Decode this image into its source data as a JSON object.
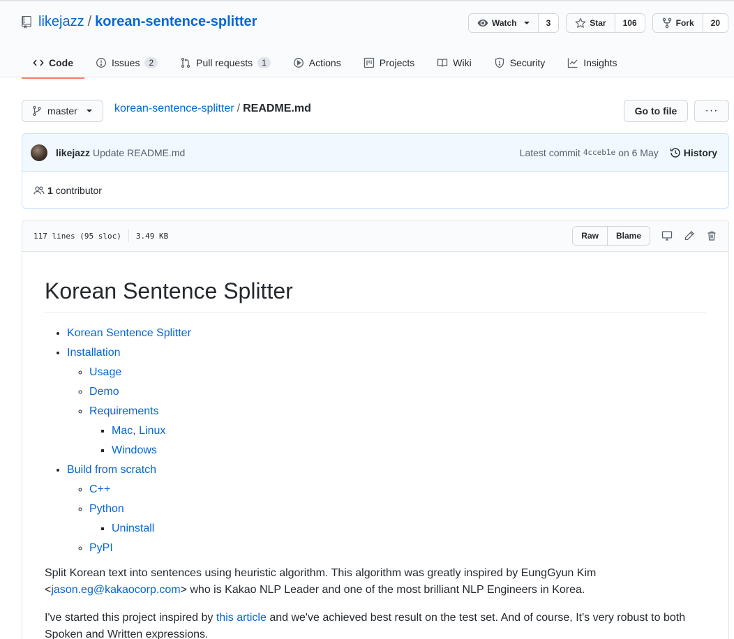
{
  "repo": {
    "owner": "likejazz",
    "separator": "/",
    "name": "korean-sentence-splitter"
  },
  "actions": {
    "watch_label": "Watch",
    "watch_count": "3",
    "star_label": "Star",
    "star_count": "106",
    "fork_label": "Fork",
    "fork_count": "20"
  },
  "tabs": [
    {
      "label": "Code",
      "icon": "code-icon"
    },
    {
      "label": "Issues",
      "count": "2",
      "icon": "issue-icon"
    },
    {
      "label": "Pull requests",
      "count": "1",
      "icon": "pull-request-icon"
    },
    {
      "label": "Actions",
      "icon": "play-icon"
    },
    {
      "label": "Projects",
      "icon": "project-icon"
    },
    {
      "label": "Wiki",
      "icon": "book-icon"
    },
    {
      "label": "Security",
      "icon": "shield-icon"
    },
    {
      "label": "Insights",
      "icon": "graph-icon"
    }
  ],
  "branch": {
    "label": "master"
  },
  "breadcrumb": {
    "repo": "korean-sentence-splitter",
    "separator": "/",
    "file": "README.md"
  },
  "go_to_file": "Go to file",
  "more": "···",
  "commit": {
    "author": "likejazz",
    "message": "Update README.md",
    "latest_label": "Latest commit",
    "sha": "4cceb1e",
    "date": "on 6 May",
    "history_label": "History",
    "contributors_count": "1",
    "contributors_label": "contributor"
  },
  "file": {
    "lines_info": "117 lines (95 sloc)",
    "size": "3.49 KB",
    "raw_label": "Raw",
    "blame_label": "Blame"
  },
  "readme": {
    "title": "Korean Sentence Splitter",
    "toc": {
      "item1": "Korean Sentence Splitter",
      "item2": "Installation",
      "usage": "Usage",
      "demo": "Demo",
      "requirements": "Requirements",
      "mac_linux": "Mac, Linux",
      "windows": "Windows",
      "item3": "Build from scratch",
      "cpp": "C++",
      "python": "Python",
      "uninstall": "Uninstall",
      "pypi": "PyPI"
    },
    "p1_before": "Split Korean text into sentences using heuristic algorithm. This algorithm was greatly inspired by EungGyun Kim <",
    "p1_email": "jason.eg@kakaocorp.com",
    "p1_after": "> who is Kakao NLP Leader and one of the most brilliant NLP Engineers in Korea.",
    "p2_before": "I've started this project inspired by ",
    "p2_link": "this article",
    "p2_after": " and we've achieved best result on the test set. And of course, It's very robust to both Spoken and Written expressions."
  },
  "colors": {
    "link": "#0366d6",
    "tab_underline": "#f9826c",
    "commit_bg": "#f1f8ff"
  }
}
